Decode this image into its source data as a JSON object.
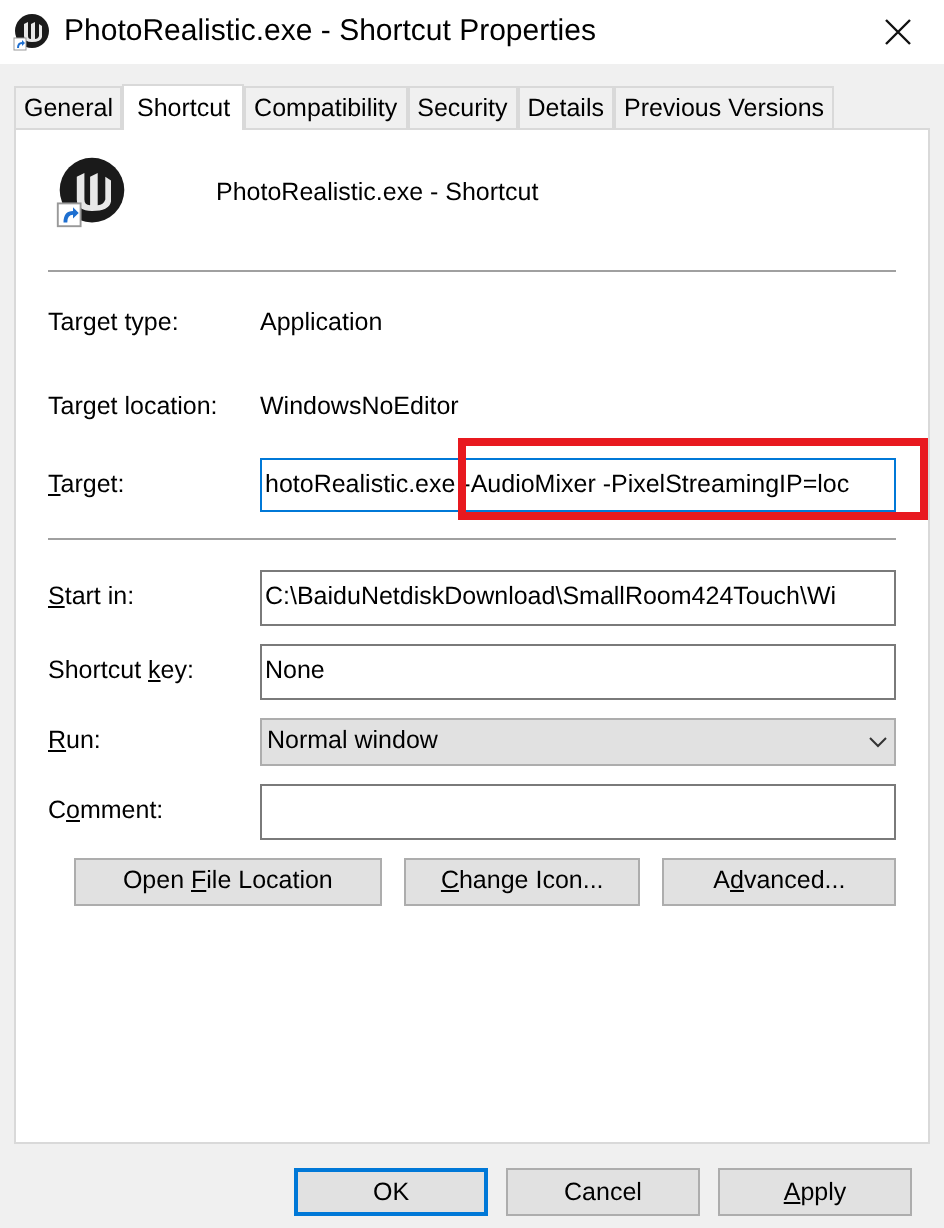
{
  "window": {
    "title": "PhotoRealistic.exe - Shortcut Properties"
  },
  "tabs": [
    {
      "label": "General",
      "selected": false
    },
    {
      "label": "Shortcut",
      "selected": true
    },
    {
      "label": "Compatibility",
      "selected": false
    },
    {
      "label": "Security",
      "selected": false
    },
    {
      "label": "Details",
      "selected": false
    },
    {
      "label": "Previous Versions",
      "selected": false
    }
  ],
  "header": {
    "name": "PhotoRealistic.exe - Shortcut"
  },
  "info": [
    {
      "label": "Target type:",
      "value": "Application"
    },
    {
      "label": "Target location:",
      "value": "WindowsNoEditor"
    }
  ],
  "target": {
    "label": {
      "key": "T",
      "post": "arget:"
    },
    "value": "hotoRealistic.exe -AudioMixer -PixelStreamingIP=loc",
    "focused": true,
    "highlighted": true
  },
  "fields": [
    {
      "kind": "text",
      "label": {
        "key": "S",
        "post": "tart in:"
      },
      "value": "C:\\BaiduNetdiskDownload\\SmallRoom424Touch\\Wi"
    },
    {
      "kind": "text",
      "label": {
        "pre": "Shortcut ",
        "key": "k",
        "post": "ey:"
      },
      "value": "None"
    },
    {
      "kind": "select",
      "label": {
        "key": "R",
        "post": "un:"
      },
      "value": "Normal window"
    },
    {
      "kind": "text",
      "label": {
        "pre": "C",
        "key": "o",
        "post": "mment:"
      }
    }
  ],
  "actions": [
    {
      "pre": "Open ",
      "key": "F",
      "post": "ile Location"
    },
    {
      "key": "C",
      "post": "hange Icon..."
    },
    {
      "pre": "A",
      "key": "d",
      "post": "vanced..."
    }
  ],
  "buttons": [
    {
      "pre": "OK"
    },
    {
      "pre": "Cancel"
    },
    {
      "key": "A",
      "post": "pply"
    }
  ]
}
